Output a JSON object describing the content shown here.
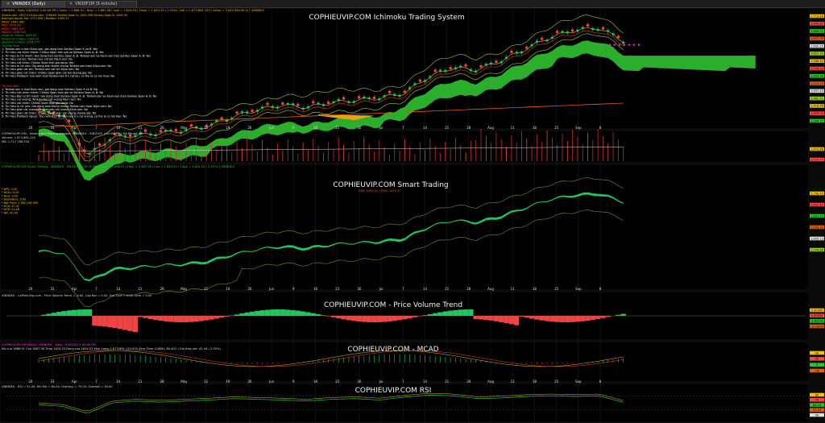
{
  "tabs": [
    {
      "label": "VNINDEX (Daily)",
      "active": true
    },
    {
      "label": "VN30F1M (5-minute)",
      "active": false
    }
  ],
  "colors": {
    "bull": "#22c55e",
    "bear": "#ef4444",
    "cloud": "#32cd32",
    "magenta": "#ff1ee6",
    "bg": "#000000"
  },
  "icons": {
    "close": "close-x-icon"
  },
  "panes": {
    "ichimoku": {
      "title": "COPHIEUVIP.COM Ichimoku Trading System",
      "header": "VNINDEX - Daily    9/8/2025 2:45:00 PM  |  Open = 1,668.91  |  High = 1,687.36  |  Low = 1,624.53  |  Close = 1,624.53 (-2.55%)  |  Vol = 1,873,861,120  |  Value = 3,042,944.00 ty  |  VNINDEX",
      "legend": [
        {
          "text": "Tenkan-sen: 1657.01   Kijun-sen: 1588.64   Senkou Span A: 1491.098   Senkou Span B: 1405.00",
          "color": "#f0c000"
        },
        {
          "text": "Bollinger Bands Top: 1711.862  |  Bottom: 1583.57",
          "color": "#f0c000"
        },
        {
          "text": "MA20: 1647.385",
          "color": "#f0c000"
        },
        {
          "text": "MA5: 1670.26",
          "color": "#ff5555"
        },
        {
          "text": "MA10: 1663.307",
          "color": "#ff5555"
        },
        {
          "text": "MA200: 1344.523",
          "color": "#ff5555"
        },
        {
          "text": "Close Vs Chikou: 1602.52",
          "color": "#2ec42e"
        },
        {
          "text": "Tenkan Vs Chikou: 1336.33",
          "color": "#2ec42e"
        },
        {
          "text": "SpanB Vs Chikou: 1254.275",
          "color": "#2ec42e"
        },
        {
          "text": "Tin hieu Mua",
          "color": "#2ec42e"
        },
        {
          "text": "1. Tenkan-sen o tren Kijun-sen, gia dong tren Senkou Span A va B: Yes",
          "color": "#ffffff"
        },
        {
          "text": "2. Tin hieu cat chien manh: Chikou Span tren gia va Senkou Span A, B: Yes",
          "color": "#ffffff"
        },
        {
          "text": "3. Tin hieu tu tin manh: Gia dong tren Senkou Span A, B. Tenkan-sen va Kijun-sen tren Senkou Span A, B: Yes",
          "color": "#ffffff"
        },
        {
          "text": "4. Tin hieu cat len: Tenkan-sen cat len Kijun-sen: No",
          "color": "#ffffff"
        },
        {
          "text": "5. Tin hieu cat chien: Chikou Span tren gia dong: Yes",
          "color": "#ffffff"
        },
        {
          "text": "6. Tin hieu tu tin yeu: Gia dong tren Kumo nhung Tenkan-sen hoac Kijun-sen: No",
          "color": "#ffffff"
        },
        {
          "text": "7. Tin hieu gian cat len: Tenkan-sen cat len Kijun-sen: No",
          "color": "#ffffff"
        },
        {
          "text": "8. Tin hieu gian cat chien: Chikou Span gian cat len duong gia: No",
          "color": "#ffffff"
        },
        {
          "text": "9. Tin hieu Pullback: Gia nam duoi Tenkan-sen tru cat len, co the la co hoi mua: No",
          "color": "#ffffff"
        },
        {
          "text": "Tin hieu Ban",
          "color": "#ff4444"
        },
        {
          "text": "1. Tenkan-sen o duoi Kijun-sen, gia dong duoi Senkou Span A va B: No",
          "color": "#ffffff"
        },
        {
          "text": "2. Tin hieu cat chien manh: Chikou Span duoi gia va Senkou Span A, B: No",
          "color": "#ffffff"
        },
        {
          "text": "3. Tin hieu Ban tu tin manh: Gia dong duoi Senkou Span A, B. Tenkan-sen va Kijun-sen duoi Senkou Span A, B: No",
          "color": "#ffffff"
        },
        {
          "text": "4. Tin hieu cat xuong: Tenkan-sen cat xuong Kijun-sen: No",
          "color": "#ffffff"
        },
        {
          "text": "5. Tin hieu cat chien: Chikou Span duoi gia dong: No",
          "color": "#ffffff"
        },
        {
          "text": "6. Tin hieu tu tin yeu: Gia dong duoi Kumo nhung Tenkan-sen hoac Kijun-sen: No",
          "color": "#ffffff"
        },
        {
          "text": "7. Tin hieu gian cat xuong: Tenkan-sen cat xuong Kijun-sen: No",
          "color": "#ffffff"
        },
        {
          "text": "8. Tin hieu gian cat chien: Chikou Span gian cat xuong duong gia: No",
          "color": "#ffffff"
        },
        {
          "text": "9. Tin hieu Pullback nguoc: Gia nam tren Tenkan-sen tru cat xuong, co the la co hoi ban: No",
          "color": "#ffffff"
        }
      ],
      "price_labels": [
        "1,713.86",
        "1,690.81",
        "1,668.01",
        "1,647.39",
        "1,632.15",
        "1,622.93",
        "1,588.64",
        "1,576.03",
        "1,543.98",
        "1,521.20",
        "1,497.43",
        "1,462.51",
        "1,418.46",
        "1,405.00",
        "1,344.52"
      ]
    },
    "volume": {
      "header": "COPHIEUVIP.COM - Volume and Moving Average - VNINDEX - 9/8/2025 2:45:00 PM | MA Period: 20",
      "legend": [
        "Volume: 1,873,861,120",
        "MA: 1,717,768,334"
      ],
      "price_labels": [
        "1,873.86",
        "1,717.77"
      ]
    },
    "smart": {
      "title": "COPHIEUVIP.COM Smart Trading",
      "header": "COPHIEUVIP.COM Smart Trading  -  VNINDEX - 9/8/2025 2:45:00 PM  |  Open = 1,668.91  |  High = 1,687.36  |  Low = 1,624.53  |  Close = 1,624.53 (-2.55%)  |  VNINDEX",
      "sublabel": "SAR: 1695.01  |  EMA: 1652.47",
      "legend": [
        {
          "text": "* BPS:  0.00",
          "color": "#f0c000"
        },
        {
          "text": "* BCAL:  0.00",
          "color": "#f0c000"
        },
        {
          "text": "* BCal:  0.00",
          "color": "#f0c000"
        },
        {
          "text": "* BookValue:  0.00",
          "color": "#f0c000"
        },
        {
          "text": "* Net Price: 1,582,206,999",
          "color": "#f0c000"
        },
        {
          "text": "* ROA:  37.31",
          "color": "#f0c000"
        },
        {
          "text": "* ROE:  21.48",
          "color": "#f0c000"
        },
        {
          "text": "* BPI:  40.00",
          "color": "#f0c000"
        }
      ],
      "price_labels": [
        "1,758.40",
        "1,652.47",
        "1,624.53",
        "1,556.32",
        "1,405.13",
        "1,254.86"
      ]
    },
    "pvt": {
      "title": "COPHIEUVIP.COM - Price Volume Trend",
      "header": "VNINDEX - CoPhieuVip.com - Price Volume Trend = -4.82,  Cap Bar = 0.00,  Gen Line = 0.00, Sem = 0.00",
      "price_labels": [
        "0.50000",
        "0.00000",
        "-4.82000",
        "-10.0000"
      ]
    },
    "macd": {
      "title": "COPHIEUVIP.COM - MCAD",
      "header": "COPHIEUVIP.COM MACD - VNINDEX  -  Daily  -  9/8/2025 2:45:00 PM",
      "sub": "Mo cua 1668.91  Cao 1687.36  Thap 1624.53  Dong cua 1624.53  Khoi luong 1,873,861,120.000  Zero Time 11888 ( 80.402 )  Gia thay doi -42.44 (-2.55%)",
      "price_labels": [
        "40",
        "20",
        "0",
        "-20"
      ]
    },
    "rsi": {
      "title": "COPHIEUVIP.COM RSI",
      "header": "VNINDEX - RSI = 51.49,  RSI MA = 64.44,  Overbuy = 70.00,  Oversell = 30.00",
      "price_labels": [
        "80",
        "70",
        "64.44",
        "51.49",
        "30"
      ]
    }
  },
  "x_axis": {
    "labels": [
      "24",
      "31",
      "Apr",
      "7",
      "14",
      "21",
      "28",
      "May",
      "12",
      "19",
      "26",
      "Jun",
      "9",
      "16",
      "23",
      "30",
      "Jul",
      "7",
      "14",
      "21",
      "28",
      "Aug",
      "11",
      "18",
      "25",
      "Sep",
      "8"
    ],
    "month_labels": [
      "Apr",
      "May",
      "Jun",
      "Jul",
      "Aug",
      "Sep"
    ]
  },
  "chart_data": {
    "type": "line",
    "x": [
      "2025-03-24",
      "2025-03-31",
      "2025-04-07",
      "2025-04-14",
      "2025-04-21",
      "2025-04-28",
      "2025-05-05",
      "2025-05-12",
      "2025-05-19",
      "2025-05-26",
      "2025-06-02",
      "2025-06-09",
      "2025-06-16",
      "2025-06-23",
      "2025-06-30",
      "2025-07-07",
      "2025-07-14",
      "2025-07-21",
      "2025-07-28",
      "2025-08-04",
      "2025-08-11",
      "2025-08-18",
      "2025-08-25",
      "2025-09-01",
      "2025-09-08"
    ],
    "series": [
      {
        "name": "Close",
        "values": [
          1320,
          1310,
          1130,
          1210,
          1220,
          1230,
          1240,
          1260,
          1300,
          1330,
          1350,
          1340,
          1360,
          1370,
          1380,
          1400,
          1470,
          1510,
          1500,
          1540,
          1590,
          1640,
          1670,
          1680,
          1624.53
        ]
      },
      {
        "name": "RSI",
        "values": [
          45,
          40,
          20,
          50,
          55,
          52,
          55,
          58,
          62,
          60,
          58,
          55,
          60,
          62,
          58,
          66,
          72,
          70,
          62,
          64,
          68,
          70,
          68,
          70,
          51.49
        ]
      }
    ],
    "xlabel": "",
    "ylabel": ""
  }
}
